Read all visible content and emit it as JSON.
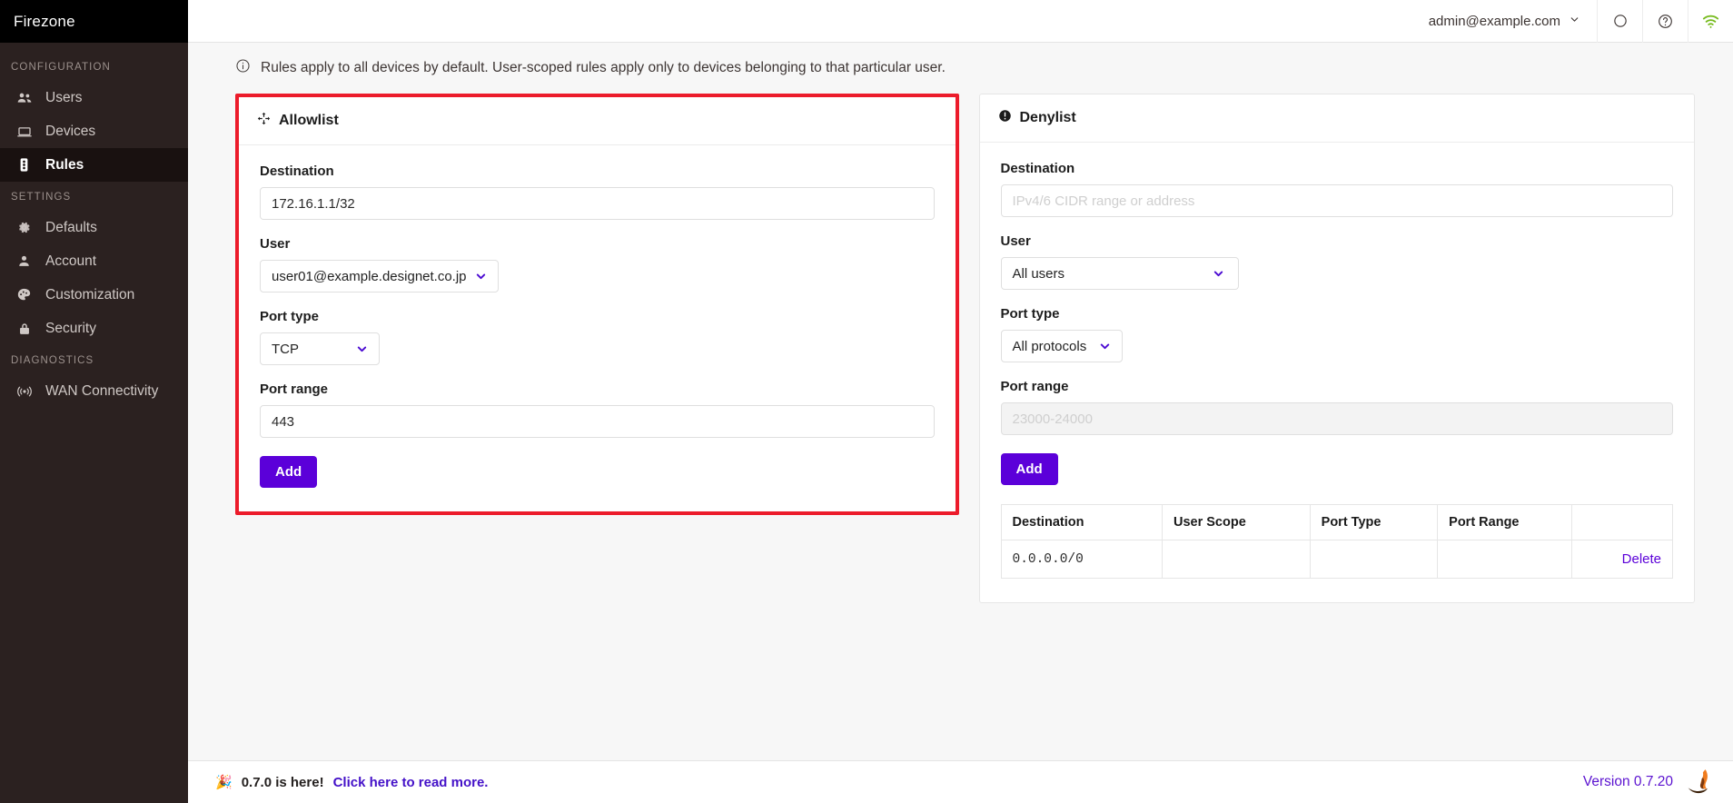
{
  "brand": {
    "name": "Firezone"
  },
  "sidebar": {
    "sections": [
      {
        "label": "CONFIGURATION",
        "items": [
          {
            "label": "Users",
            "icon": "users-icon",
            "active": false
          },
          {
            "label": "Devices",
            "icon": "laptop-icon",
            "active": false
          },
          {
            "label": "Rules",
            "icon": "traffic-light-icon",
            "active": true
          }
        ]
      },
      {
        "label": "SETTINGS",
        "items": [
          {
            "label": "Defaults",
            "icon": "gear-icon",
            "active": false
          },
          {
            "label": "Account",
            "icon": "person-icon",
            "active": false
          },
          {
            "label": "Customization",
            "icon": "palette-icon",
            "active": false
          },
          {
            "label": "Security",
            "icon": "lock-icon",
            "active": false
          }
        ]
      },
      {
        "label": "DIAGNOSTICS",
        "items": [
          {
            "label": "WAN Connectivity",
            "icon": "broadcast-icon",
            "active": false
          }
        ]
      }
    ]
  },
  "topbar": {
    "account": "admin@example.com",
    "chevron_icon": "chevron-down-icon",
    "circle_icon": "circle-icon",
    "help_icon": "question-circle-icon",
    "wifi_icon": "wifi-icon",
    "wifi_color": "#77bb1f"
  },
  "banner": {
    "icon": "info-circle-icon",
    "text": "Rules apply to all devices by default. User-scoped rules apply only to devices belonging to that particular user."
  },
  "allowlist": {
    "title": "Allowlist",
    "icon": "move-arrows-icon",
    "highlight_color": "#ec1c2b",
    "destination_label": "Destination",
    "destination_value": "172.16.1.1/32",
    "destination_placeholder": "IPv4/6 CIDR range or address",
    "user_label": "User",
    "user_value": "user01@example.designet.co.jp",
    "port_type_label": "Port type",
    "port_type_value": "TCP",
    "port_range_label": "Port range",
    "port_range_value": "443",
    "port_range_placeholder": "23000-24000",
    "add_label": "Add"
  },
  "denylist": {
    "title": "Denylist",
    "icon": "exclamation-circle-icon",
    "destination_label": "Destination",
    "destination_value": "",
    "destination_placeholder": "IPv4/6 CIDR range or address",
    "user_label": "User",
    "user_value": "All users",
    "port_type_label": "Port type",
    "port_type_value": "All protocols",
    "port_range_label": "Port range",
    "port_range_value": "",
    "port_range_placeholder": "23000-24000",
    "add_label": "Add",
    "table": {
      "columns": [
        "Destination",
        "User Scope",
        "Port Type",
        "Port Range",
        ""
      ],
      "rows": [
        {
          "destination": "0.0.0.0/0",
          "user_scope": "",
          "port_type": "",
          "port_range": "",
          "action": "Delete"
        }
      ]
    }
  },
  "footer": {
    "emoji": "🎉",
    "release_text": "0.7.0 is here!",
    "release_link": "Click here to read more.",
    "version": "Version 0.7.20",
    "logo": "firezone-flame-logo"
  },
  "colors": {
    "accent": "#5b00d9",
    "link": "#4411c8",
    "highlight": "#ec1c2b",
    "sidebar_bg": "#2b2120"
  }
}
